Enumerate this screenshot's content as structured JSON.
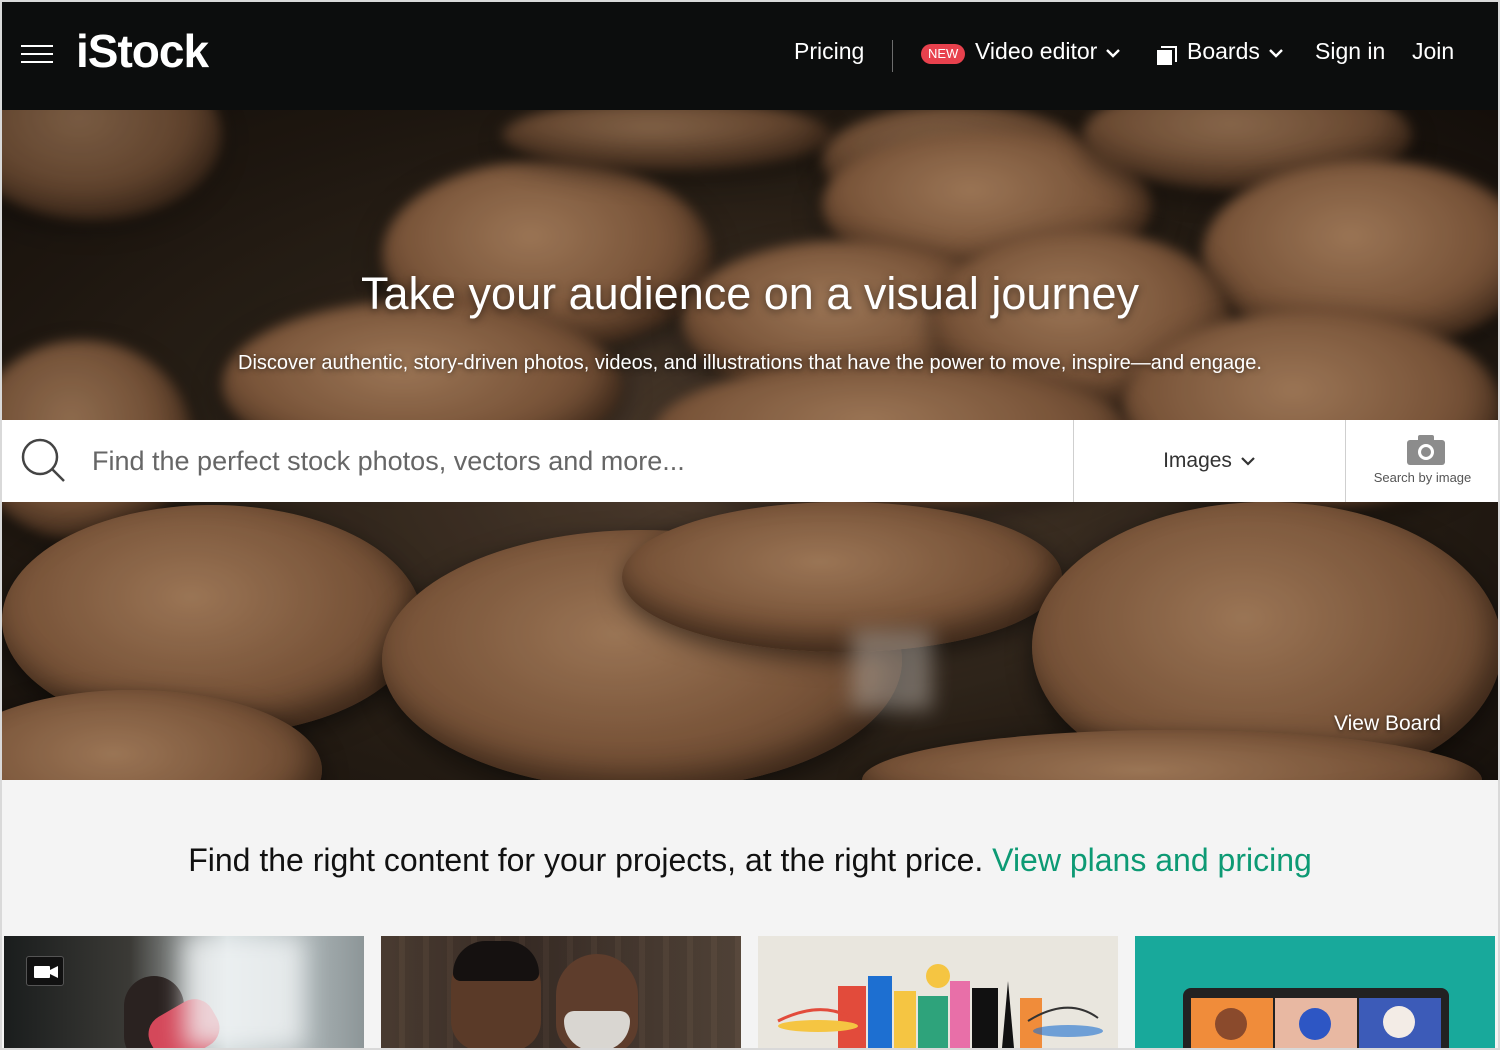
{
  "header": {
    "logo": "iStock",
    "nav": {
      "pricing": "Pricing",
      "new_badge": "NEW",
      "video_editor": "Video editor",
      "boards": "Boards",
      "sign_in": "Sign in",
      "join": "Join"
    }
  },
  "hero": {
    "title": "Take your audience on a visual journey",
    "subtitle": "Discover authentic, story-driven photos, videos, and illustrations that have the power to move, inspire—and engage.",
    "view_board": "View Board"
  },
  "search": {
    "placeholder": "Find the perfect stock photos, vectors and more...",
    "type_selected": "Images",
    "by_image_label": "Search by image"
  },
  "promo": {
    "text": "Find the right content for your projects, at the right price.",
    "link": "View plans and pricing"
  },
  "colors": {
    "header_bg": "#0c0d0d",
    "accent_green": "#0d9a74",
    "badge_red": "#e8414d",
    "page_bg": "#f4f4f4"
  },
  "icons": [
    "hamburger-menu-icon",
    "chevron-down-icon",
    "boards-icon",
    "search-icon",
    "camera-icon",
    "video-camera-icon"
  ]
}
